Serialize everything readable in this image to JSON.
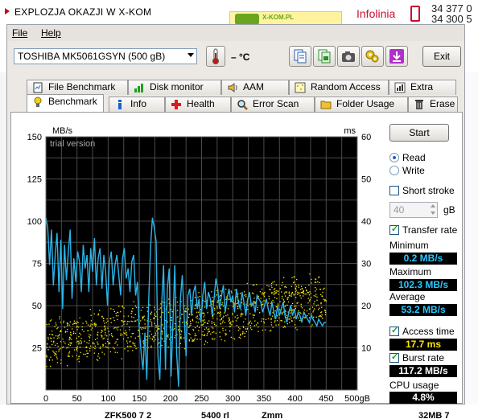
{
  "background_page": {
    "promo_text": "EXPLOZJA OKAZJI W X-KOM",
    "banner_brand": "X-KOM.PL",
    "infolinia": "Infolinia",
    "phone_number": "34 377 0",
    "phone_number_2": "34 300 5",
    "bottom_text_1": "ZFK500 7 2",
    "bottom_text_2": "5400 rl",
    "bottom_text_3": "Zmm",
    "bottom_text_4": "32MB 7"
  },
  "menubar": {
    "file": "File",
    "help": "Help"
  },
  "toolbar": {
    "drive": "TOSHIBA MK5061GSYN (500 gB)",
    "temperature": "– °C",
    "exit_label": "Exit",
    "icons": [
      "copy-text-icon",
      "copy-image-icon",
      "screenshot-camera-icon",
      "options-icon",
      "save-download-icon"
    ]
  },
  "tabs_top": [
    {
      "label": "File Benchmark",
      "icon": "file-benchmark-icon"
    },
    {
      "label": "Disk monitor",
      "icon": "disk-monitor-icon"
    },
    {
      "label": "AAM",
      "icon": "aam-speaker-icon"
    },
    {
      "label": "Random Access",
      "icon": "random-access-icon"
    },
    {
      "label": "Extra tests",
      "icon": "extra-tests-icon"
    }
  ],
  "tabs_bottom": [
    {
      "label": "Benchmark",
      "icon": "benchmark-bulb-icon"
    },
    {
      "label": "Info",
      "icon": "info-icon"
    },
    {
      "label": "Health",
      "icon": "health-cross-icon"
    },
    {
      "label": "Error Scan",
      "icon": "error-scan-magnifier-icon"
    },
    {
      "label": "Folder Usage",
      "icon": "folder-usage-icon"
    },
    {
      "label": "Erase",
      "icon": "erase-trash-icon"
    }
  ],
  "controls": {
    "start_label": "Start",
    "read_label": "Read",
    "write_label": "Write",
    "short_stroke_label": "Short stroke",
    "short_stroke_value": "40",
    "short_stroke_unit": "gB",
    "transfer_rate_label": "Transfer rate",
    "minimum_label": "Minimum",
    "minimum_value": "0.2 MB/s",
    "maximum_label": "Maximum",
    "maximum_value": "102.3 MB/s",
    "average_label": "Average",
    "average_value": "53.2 MB/s",
    "access_time_label": "Access time",
    "access_time_value": "17.7 ms",
    "burst_rate_label": "Burst rate",
    "burst_rate_value": "117.2 MB/s",
    "cpu_usage_label": "CPU usage",
    "cpu_usage_value": "4.8%",
    "read_selected": true,
    "short_stroke_checked": false,
    "transfer_rate_checked": true,
    "access_time_checked": true,
    "burst_rate_checked": true
  },
  "chart_data": {
    "type": "line",
    "watermark": "trial version",
    "left_axis_unit": "MB/s",
    "right_axis_unit": "ms",
    "x_unit": "gB",
    "left_ticks": [
      25,
      50,
      75,
      100,
      125,
      150
    ],
    "right_ticks": [
      10,
      20,
      30,
      40,
      50,
      60
    ],
    "x_ticks": [
      0,
      50,
      100,
      150,
      200,
      250,
      300,
      350,
      400,
      450,
      500
    ],
    "xlim": [
      0,
      500
    ],
    "ylim_left": [
      0,
      150
    ],
    "ylim_right": [
      0,
      60
    ],
    "grid": true,
    "series": [
      {
        "label": "transfer rate",
        "axis": "left",
        "color": "#2ab4e8",
        "x": [
          0,
          3,
          6,
          9,
          12,
          15,
          18,
          21,
          24,
          27,
          30,
          33,
          36,
          39,
          42,
          45,
          48,
          51,
          54,
          57,
          60,
          63,
          66,
          69,
          72,
          75,
          78,
          81,
          84,
          87,
          90,
          93,
          96,
          99,
          102,
          105,
          108,
          111,
          114,
          117,
          120,
          123,
          126,
          129,
          132,
          135,
          138,
          141,
          144,
          147,
          150,
          153,
          156,
          159,
          162,
          165,
          168,
          171,
          174,
          177,
          180,
          183,
          186,
          189,
          192,
          195,
          198,
          201,
          204,
          207,
          210,
          213,
          216,
          219,
          222,
          225,
          228,
          231,
          234,
          237,
          240,
          243,
          246,
          249,
          252,
          255,
          258,
          261,
          264,
          267,
          270,
          273,
          276,
          279,
          282,
          285,
          288,
          291,
          294,
          297,
          300,
          303,
          306,
          309,
          312,
          315,
          318,
          321,
          324,
          327,
          330,
          333,
          336,
          339,
          342,
          345,
          348,
          351,
          354,
          357,
          360,
          363,
          366,
          369,
          372,
          375,
          378,
          381,
          384,
          387,
          390,
          393,
          396,
          399,
          402,
          405,
          408,
          411,
          414,
          417,
          420,
          423,
          426,
          429,
          432,
          435,
          438,
          441,
          444,
          447,
          450
        ],
        "y": [
          102,
          96,
          74,
          95,
          62,
          80,
          93,
          58,
          89,
          48,
          86,
          65,
          82,
          95,
          54,
          78,
          64,
          82,
          76,
          58,
          86,
          72,
          80,
          58,
          84,
          70,
          90,
          62,
          78,
          84,
          60,
          80,
          70,
          50,
          76,
          82,
          62,
          74,
          80,
          68,
          56,
          78,
          84,
          66,
          72,
          58,
          76,
          80,
          56,
          64,
          36,
          22,
          12,
          34,
          6,
          52,
          84,
          102,
          96,
          88,
          20,
          6,
          52,
          74,
          12,
          60,
          72,
          8,
          40,
          74,
          22,
          2,
          54,
          68,
          44,
          20,
          56,
          60,
          44,
          58,
          62,
          48,
          54,
          40,
          56,
          64,
          48,
          58,
          54,
          44,
          54,
          66,
          60,
          48,
          56,
          62,
          46,
          54,
          60,
          52,
          56,
          46,
          60,
          52,
          48,
          58,
          52,
          44,
          54,
          58,
          50,
          52,
          46,
          56,
          54,
          52,
          46,
          50,
          54,
          48,
          44,
          52,
          46,
          42,
          50,
          44,
          48,
          52,
          44,
          40,
          46,
          50,
          44,
          48,
          42,
          46,
          44,
          40,
          46,
          44,
          42,
          40,
          44,
          42,
          40,
          38,
          42,
          40,
          38,
          40,
          40
        ]
      },
      {
        "label": "access time",
        "axis": "right",
        "color": "#ffee00",
        "style": "scatter"
      }
    ]
  }
}
